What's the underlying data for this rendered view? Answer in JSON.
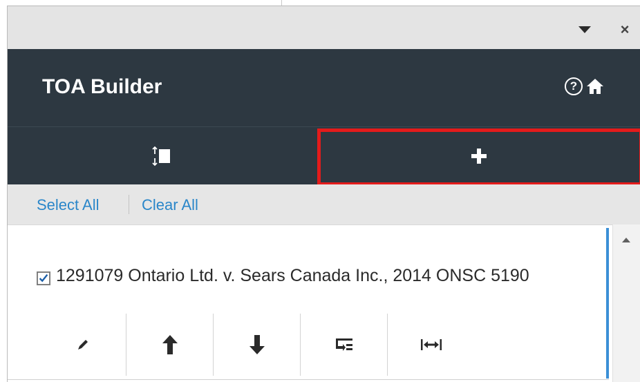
{
  "pane": {
    "menu_icon": "chevron-down-icon",
    "close_glyph": "×"
  },
  "header": {
    "title": "TOA Builder",
    "help_glyph": "?",
    "icons": [
      "help-icon",
      "home-icon"
    ],
    "background": "#2d3841"
  },
  "tabs": [
    {
      "name": "reorder",
      "icon": "reorder-icon"
    },
    {
      "name": "add",
      "icon": "plus-icon",
      "highlighted": true
    }
  ],
  "selection": {
    "select_all": "Select All",
    "clear_all": "Clear All",
    "link_color": "#2a86c9"
  },
  "list": {
    "items": [
      {
        "checked": true,
        "citation": "1291079 Ontario Ltd. v. Sears Canada Inc., 2014 ONSC 5190",
        "actions": [
          "edit-icon",
          "move-up-icon",
          "move-down-icon",
          "format-icon",
          "width-icon"
        ]
      }
    ]
  },
  "colors": {
    "highlight": "#e41b1b",
    "accent": "#3b8fd6"
  }
}
